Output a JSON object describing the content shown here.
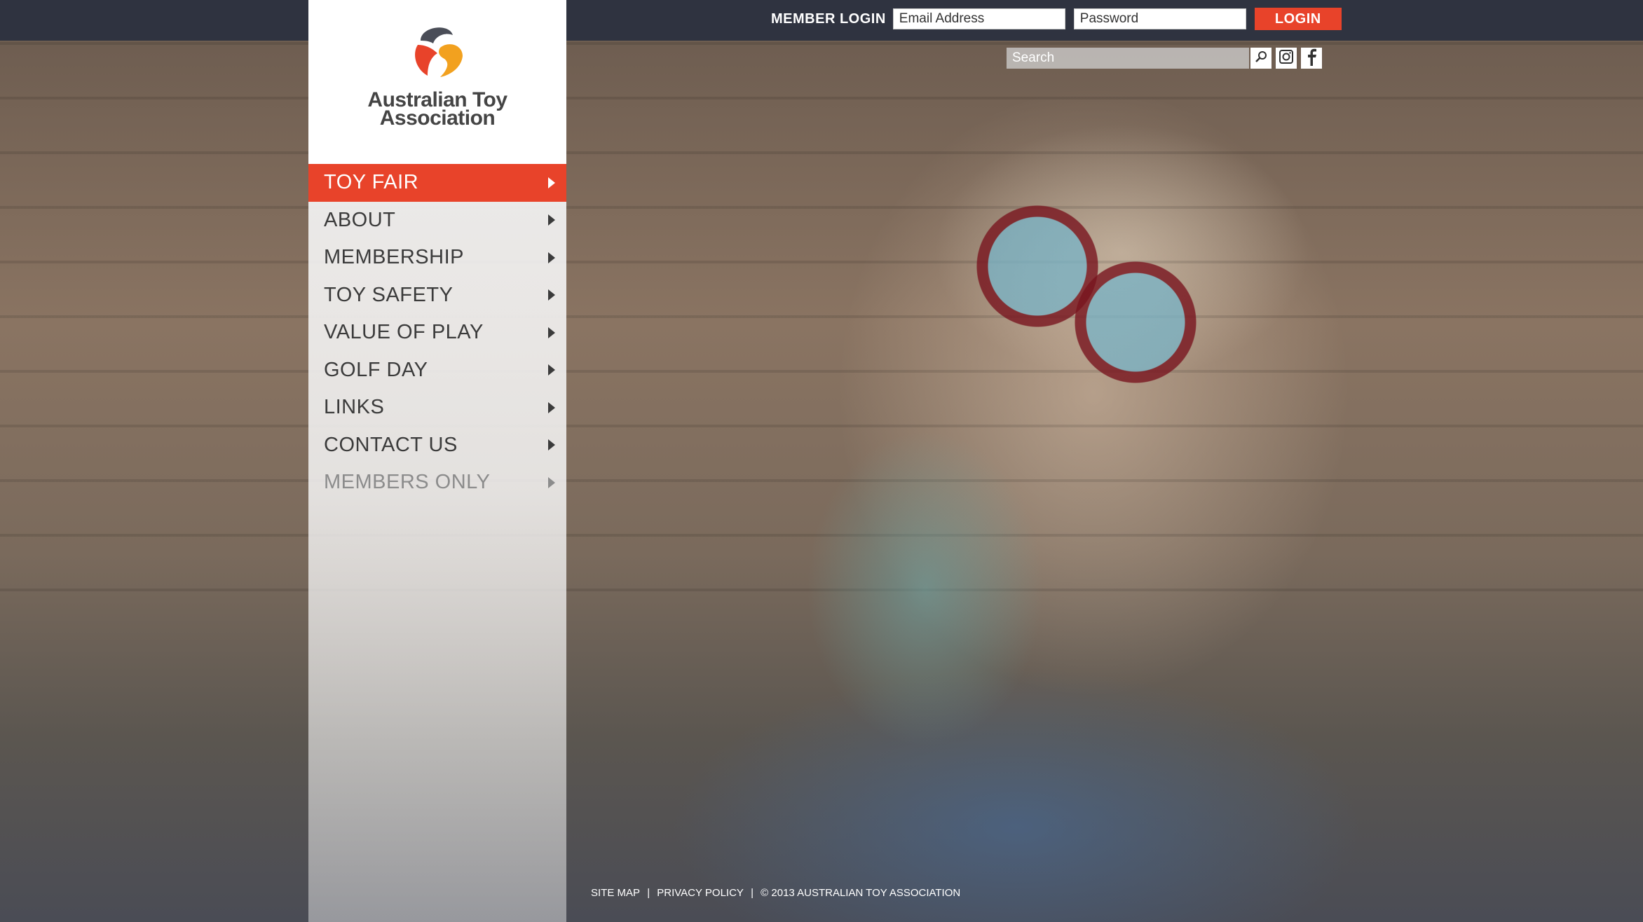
{
  "header": {
    "member_login_label": "MEMBER LOGIN",
    "email_placeholder": "Email Address",
    "password_placeholder": "Password",
    "login_button": "LOGIN",
    "search_placeholder": "Search"
  },
  "brand": {
    "name_line1": "Australian Toy",
    "name_line2": "Association",
    "accent_color": "#e8432a"
  },
  "menu": {
    "items": [
      {
        "label": "TOY FAIR"
      },
      {
        "label": "ABOUT"
      },
      {
        "label": "MEMBERSHIP"
      },
      {
        "label": "TOY SAFETY"
      },
      {
        "label": "VALUE OF PLAY"
      },
      {
        "label": "GOLF DAY"
      },
      {
        "label": "LINKS"
      },
      {
        "label": "CONTACT US"
      },
      {
        "label": "MEMBERS ONLY"
      }
    ]
  },
  "footer": {
    "site_map": "SITE MAP",
    "privacy_policy": "PRIVACY POLICY",
    "copyright": "© 2013 AUSTRALIAN TOY ASSOCIATION",
    "separator": "|"
  },
  "icons": [
    "search-icon",
    "instagram-icon",
    "facebook-icon",
    "chevron-right-icon"
  ]
}
